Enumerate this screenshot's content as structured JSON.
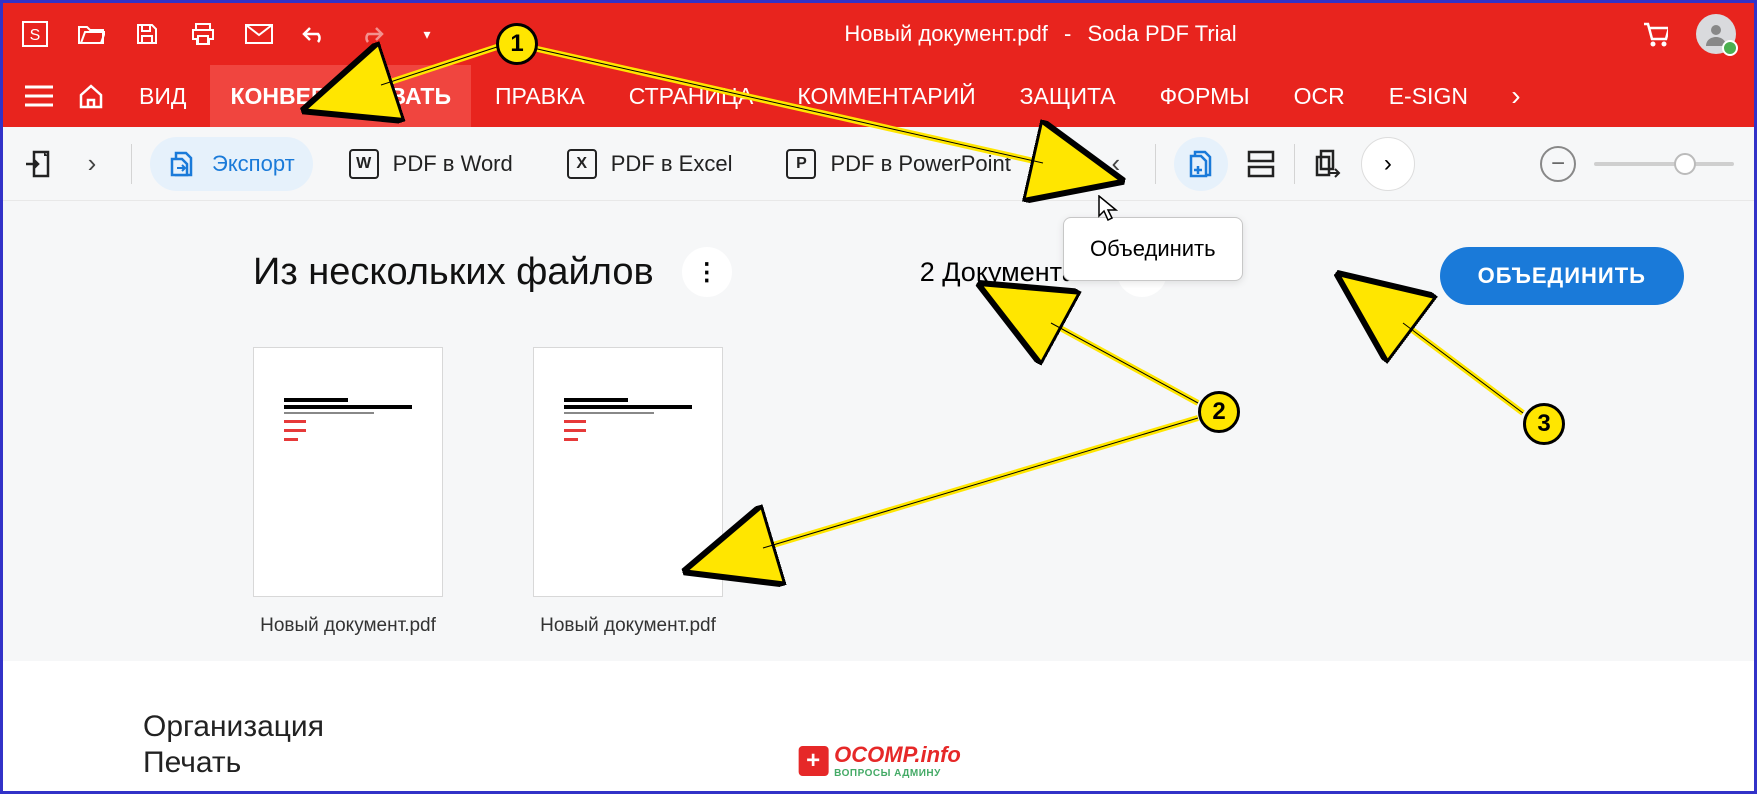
{
  "header": {
    "document_name": "Новый документ.pdf",
    "app_name": "Soda PDF Trial"
  },
  "menu": {
    "tabs": [
      "ВИД",
      "КОНВЕРТИРОВАТЬ",
      "ПРАВКА",
      "СТРАНИЦА",
      "КОММЕНТАРИЙ",
      "ЗАЩИТА",
      "ФОРМЫ",
      "OCR",
      "E-SIGN"
    ],
    "active_index": 1
  },
  "toolbar": {
    "export": "Экспорт",
    "word": "PDF в Word",
    "excel": "PDF в Excel",
    "powerpoint": "PDF в PowerPoint"
  },
  "tooltip": "Объединить",
  "main": {
    "title": "Из нескольких файлов",
    "count_label": "2 Документа",
    "merge_button": "ОБЪЕДИНИТЬ",
    "files": [
      "Новый документ.pdf",
      "Новый документ.pdf"
    ]
  },
  "bottom": {
    "line1": "Организация",
    "line2": "Печать"
  },
  "watermark": {
    "main": "OCOMP.info",
    "sub": "ВОПРОСЫ АДМИНУ"
  },
  "badges": {
    "b1": "1",
    "b2": "2",
    "b3": "3"
  }
}
